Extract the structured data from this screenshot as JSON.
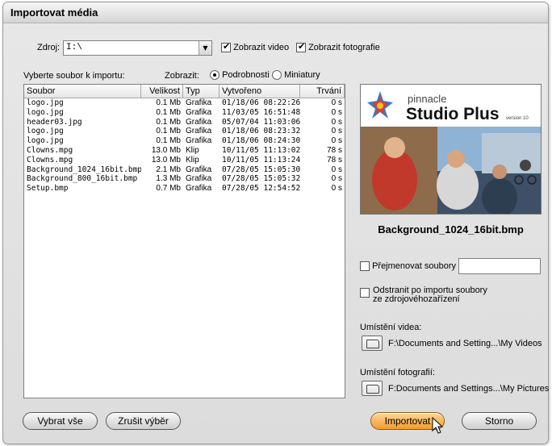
{
  "window": {
    "title": "Importovat média"
  },
  "source": {
    "label": "Zdroj:",
    "value": "I:\\",
    "show_video_label": "Zobrazit video",
    "show_video_checked": true,
    "show_photos_label": "Zobrazit fotografie",
    "show_photos_checked": true
  },
  "list": {
    "instruction": "Vyberte soubor k importu:",
    "view_label": "Zobrazit:",
    "view_details": "Podrobnosti",
    "view_thumbs": "Miniatury",
    "view_selected": "details",
    "columns": [
      "Soubor",
      "Velikost",
      "Typ",
      "Vytvořeno",
      "Trvání"
    ],
    "rows": [
      [
        "logo.jpg",
        "0.1 Mb",
        "Grafika",
        "01/18/06 08:22:26",
        "0 s"
      ],
      [
        "logo.jpg",
        "0.1 Mb",
        "Grafika",
        "11/03/05 16:51:48",
        "0 s"
      ],
      [
        "header03.jpg",
        "0.1 Mb",
        "Grafika",
        "05/07/04 11:03:06",
        "0 s"
      ],
      [
        "logo.jpg",
        "0.1 Mb",
        "Grafika",
        "01/18/06 08:23:32",
        "0 s"
      ],
      [
        "logo.jpg",
        "0.1 Mb",
        "Grafika",
        "01/18/06 08:24:30",
        "0 s"
      ],
      [
        "Clowns.mpg",
        "13.0 Mb",
        "Klip",
        "10/11/05 11:13:02",
        "78 s"
      ],
      [
        "Clowns.mpg",
        "13.0 Mb",
        "Klip",
        "10/11/05 11:13:24",
        "78 s"
      ],
      [
        "Background_1024_16bit.bmp",
        "2.1 Mb",
        "Grafika",
        "07/28/05 15:05:30",
        "0 s"
      ],
      [
        "Background_800_16bit.bmp",
        "1.3 Mb",
        "Grafika",
        "07/28/05 15:05:32",
        "0 s"
      ],
      [
        "Setup.bmp",
        "0.7 Mb",
        "Grafika",
        "07/28/05 12:54:52",
        "0 s"
      ]
    ]
  },
  "preview": {
    "brand": "pinnacle",
    "product": "Studio Plus",
    "version": "version 10",
    "filename": "Background_1024_16bit.bmp"
  },
  "options": {
    "rename_label": "Přejmenovat soubory",
    "rename_checked": false,
    "rename_value": "",
    "delete_label_line1": "Odstranit po importu soubory",
    "delete_label_line2": "ze zdrojovéhozařízení",
    "delete_checked": false
  },
  "locations": {
    "video_label": "Umístění videa:",
    "video_path": "F:\\Documents and Setting...\\My Videos",
    "photo_label": "Umístění fotografií:",
    "photo_path": "F:Documents and Settings...\\My Pictures"
  },
  "buttons": {
    "select_all": "Vybrat vše",
    "deselect": "Zrušit výběr",
    "import": "Importovat",
    "cancel": "Storno"
  }
}
